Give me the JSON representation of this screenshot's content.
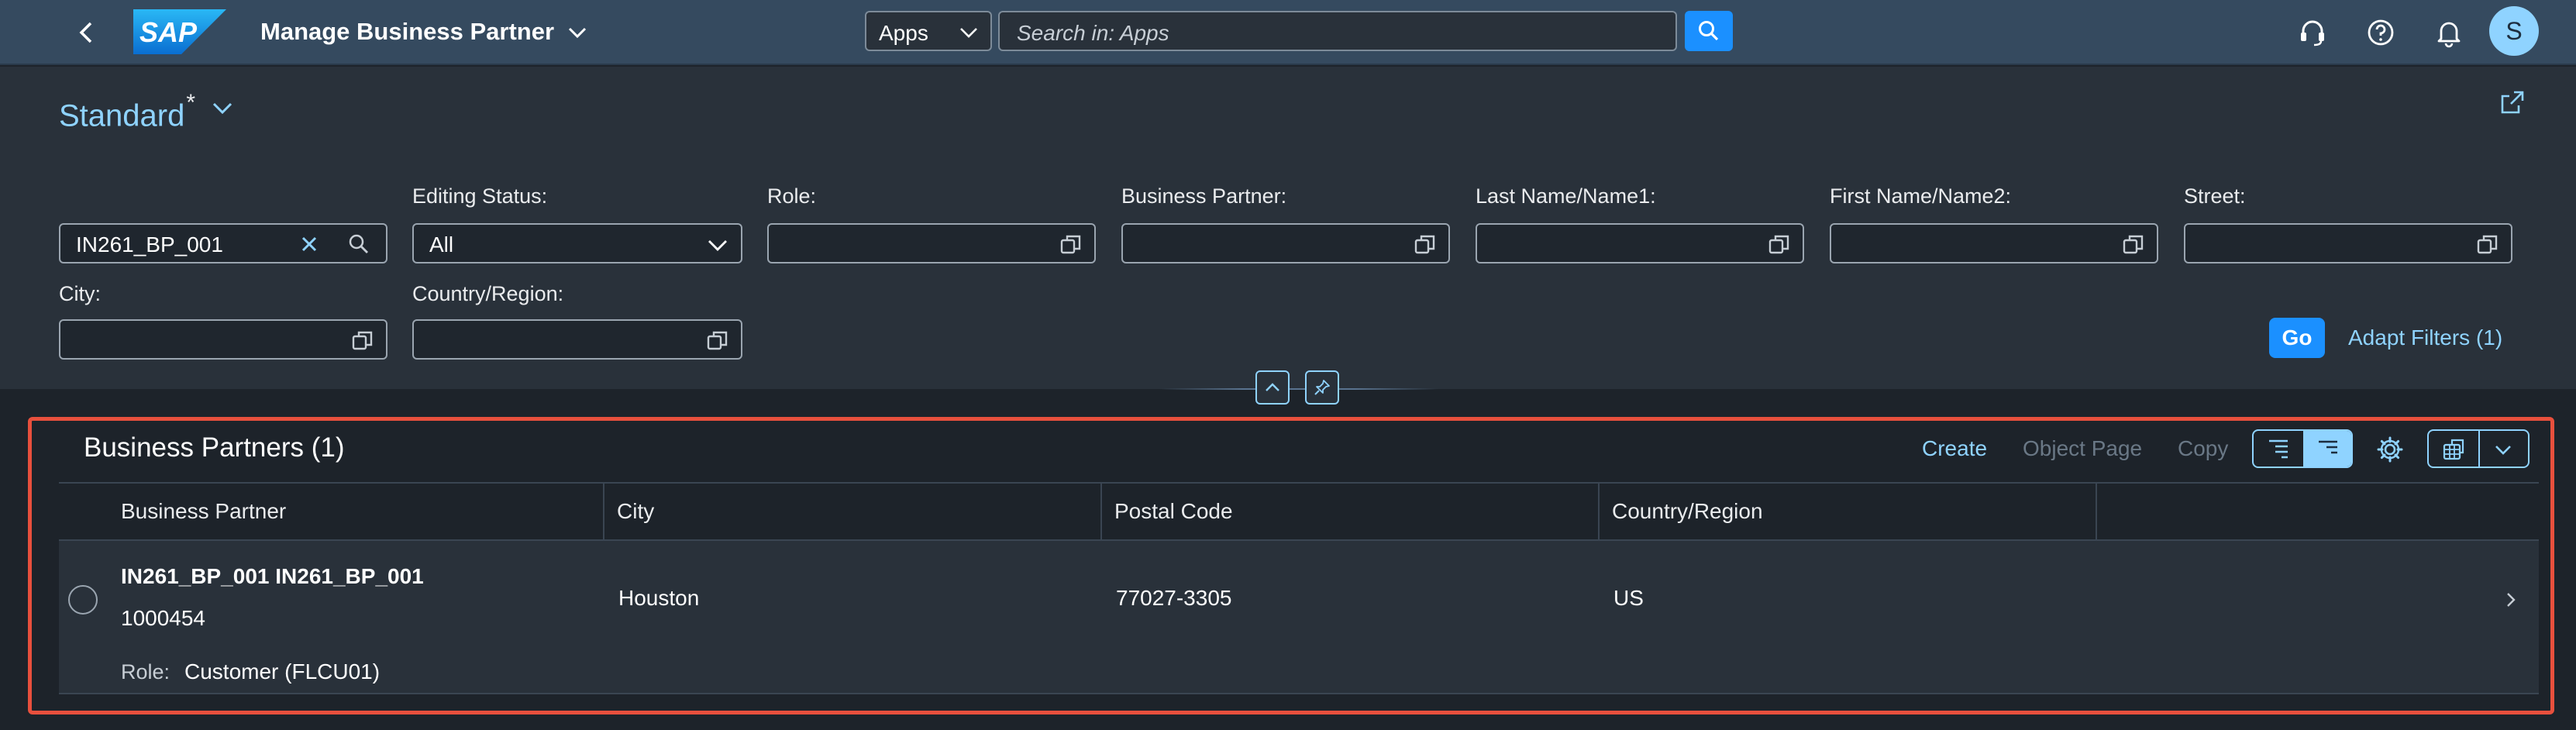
{
  "shell": {
    "logo_text": "SAP",
    "app_title": "Manage Business Partner",
    "search_scope": "Apps",
    "search_placeholder": "Search in: Apps",
    "avatar_initial": "S",
    "icons": [
      "back-icon",
      "chevron-down-icon",
      "search-icon",
      "headset-icon",
      "help-icon",
      "bell-icon"
    ]
  },
  "filter_bar": {
    "variant": "Standard",
    "variant_modified_marker": "*",
    "fields": [
      {
        "label": "",
        "value": "IN261_BP_001"
      },
      {
        "label": "Editing Status:",
        "value": "All"
      },
      {
        "label": "Role:",
        "value": ""
      },
      {
        "label": "Business Partner:",
        "value": ""
      },
      {
        "label": "Last Name/Name1:",
        "value": ""
      },
      {
        "label": "First Name/Name2:",
        "value": ""
      },
      {
        "label": "Street:",
        "value": ""
      },
      {
        "label": "City:",
        "value": ""
      },
      {
        "label": "Country/Region:",
        "value": ""
      }
    ],
    "go_label": "Go",
    "adapt_filters_label": "Adapt Filters (1)"
  },
  "table": {
    "title": "Business Partners (1)",
    "toolbar": {
      "create": "Create",
      "object_page": "Object Page",
      "copy": "Copy"
    },
    "columns": [
      "Business Partner",
      "City",
      "Postal Code",
      "Country/Region"
    ],
    "rows": [
      {
        "name": "IN261_BP_001 IN261_BP_001",
        "id": "1000454",
        "role_label": "Role:",
        "role_value": "Customer (FLCU01)",
        "city": "Houston",
        "postal_code": "77027-3305",
        "country": "US"
      }
    ]
  },
  "colors": {
    "shell": "#354a5f",
    "header": "#29313a",
    "background": "#1d232a",
    "accent": "#1b90ff",
    "link": "#8fd3ff",
    "highlight_frame": "#e8503d"
  }
}
